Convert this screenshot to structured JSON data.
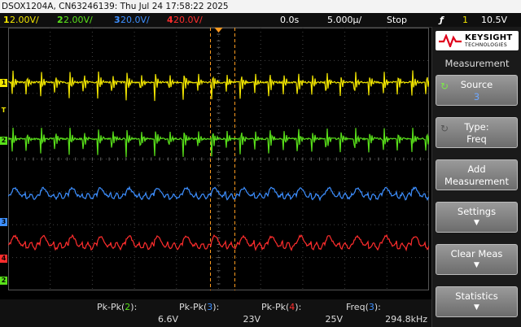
{
  "title": "DSOX1204A, CN63246139: Thu Jul 24 17:58:22 2025",
  "status": {
    "channels": [
      {
        "num": "1",
        "scale": "2.00V/",
        "color": "#f2e600"
      },
      {
        "num": "2",
        "scale": "2.00V/",
        "color": "#59e01a"
      },
      {
        "num": "3",
        "scale": "20.0V/",
        "color": "#3d8fff"
      },
      {
        "num": "4",
        "scale": "20.0V/",
        "color": "#ff2d2d"
      }
    ],
    "delay": "0.0s",
    "timebase": "5.000µ/",
    "run_state": "Stop",
    "trigger_icon": "ƒ",
    "trigger_source": "1",
    "trigger_level": "10.5V"
  },
  "markers": {
    "trigger": "T",
    "ch1": "1",
    "ch2": "2",
    "ch3": "3",
    "ch4": "4"
  },
  "measurements": [
    {
      "label": "Pk-Pk",
      "ch": "2",
      "value": "6.6V",
      "color": "#59e01a"
    },
    {
      "label": "Pk-Pk",
      "ch": "3",
      "value": "23V",
      "color": "#3d8fff"
    },
    {
      "label": "Pk-Pk",
      "ch": "4",
      "value": "25V",
      "color": "#ff2d2d"
    },
    {
      "label": "Freq",
      "ch": "3",
      "value": "294.8kHz",
      "color": "#3d8fff"
    }
  ],
  "panel": {
    "brand": "KEYSIGHT",
    "brand_sub": "TECHNOLOGIES",
    "title": "Measurement",
    "softkeys": {
      "source": {
        "label": "Source",
        "value": "3"
      },
      "type": {
        "label": "Type:",
        "value": "Freq"
      },
      "add": {
        "line1": "Add",
        "line2": "Measurement"
      },
      "settings": {
        "label": "Settings"
      },
      "clear": {
        "label": "Clear Meas"
      },
      "statistics": {
        "label": "Statistics"
      }
    }
  },
  "waveform": {
    "period_us": 3.392,
    "time_per_div_us": 5,
    "divisions": 10,
    "baseline_fraction": [
      0.208,
      0.423,
      0.642,
      0.831
    ]
  }
}
